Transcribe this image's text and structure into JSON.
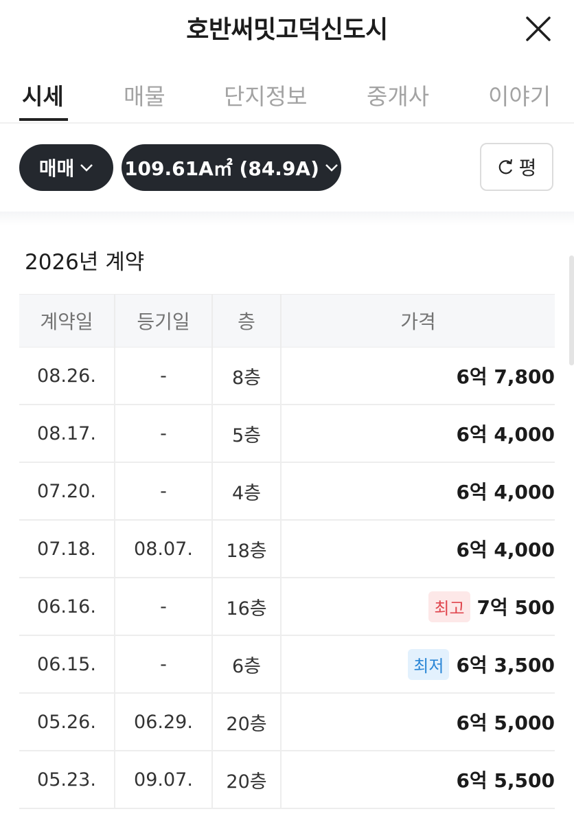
{
  "header": {
    "title": "호반써밋고덕신도시"
  },
  "tabs": [
    {
      "label": "시세",
      "active": true
    },
    {
      "label": "매물",
      "active": false
    },
    {
      "label": "단지정보",
      "active": false
    },
    {
      "label": "중개사",
      "active": false
    },
    {
      "label": "이야기",
      "active": false
    }
  ],
  "filters": {
    "deal_type": "매매",
    "area": "109.61A㎡ (84.9A)",
    "unit_toggle": "평"
  },
  "section": {
    "title": "2026년 계약"
  },
  "table": {
    "columns": [
      "계약일",
      "등기일",
      "층",
      "가격"
    ],
    "rows": [
      {
        "contract": "08.26.",
        "registered": "-",
        "floor": "8층",
        "badge": "",
        "price": "6억 7,800"
      },
      {
        "contract": "08.17.",
        "registered": "-",
        "floor": "5층",
        "badge": "",
        "price": "6억 4,000"
      },
      {
        "contract": "07.20.",
        "registered": "-",
        "floor": "4층",
        "badge": "",
        "price": "6억 4,000"
      },
      {
        "contract": "07.18.",
        "registered": "08.07.",
        "floor": "18층",
        "badge": "",
        "price": "6억 4,000"
      },
      {
        "contract": "06.16.",
        "registered": "-",
        "floor": "16층",
        "badge": "최고",
        "price": "7억 500"
      },
      {
        "contract": "06.15.",
        "registered": "-",
        "floor": "6층",
        "badge": "최저",
        "price": "6억 3,500"
      },
      {
        "contract": "05.26.",
        "registered": "06.29.",
        "floor": "20층",
        "badge": "",
        "price": "6억 5,000"
      },
      {
        "contract": "05.23.",
        "registered": "09.07.",
        "floor": "20층",
        "badge": "",
        "price": "6억 5,500"
      }
    ]
  },
  "colors": {
    "pill_bg": "#24282e",
    "badge_high": "#e0464e",
    "badge_low": "#2a86d6"
  }
}
